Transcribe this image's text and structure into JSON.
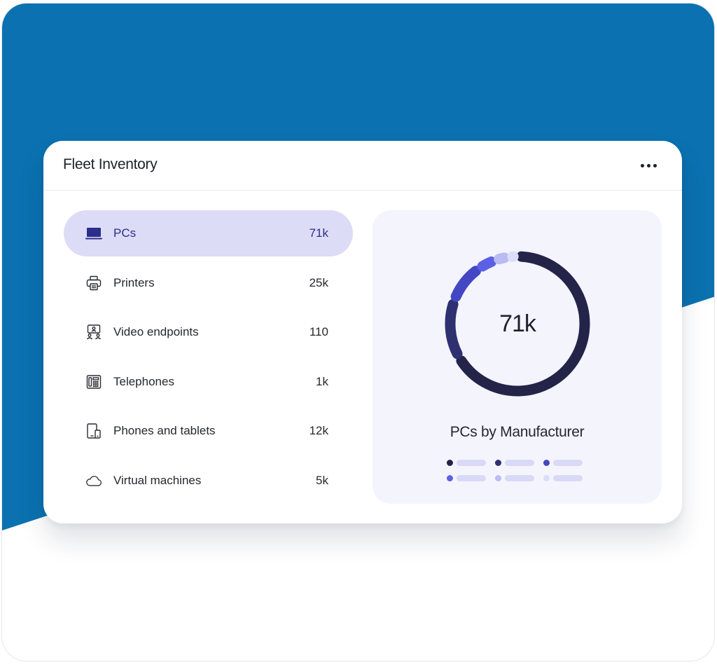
{
  "widget": {
    "title": "Fleet Inventory",
    "menu_icon": "more-horizontal-icon"
  },
  "inventory": {
    "items": [
      {
        "label": "PCs",
        "count": "71k",
        "icon": "laptop-icon",
        "selected": true
      },
      {
        "label": "Printers",
        "count": "25k",
        "icon": "printer-icon",
        "selected": false
      },
      {
        "label": "Video endpoints",
        "count": "110",
        "icon": "video-endpoint-icon",
        "selected": false
      },
      {
        "label": "Telephones",
        "count": "1k",
        "icon": "telephone-icon",
        "selected": false
      },
      {
        "label": "Phones and tablets",
        "count": "12k",
        "icon": "phone-tablet-icon",
        "selected": false
      },
      {
        "label": "Virtual machines",
        "count": "5k",
        "icon": "cloud-icon",
        "selected": false
      }
    ]
  },
  "chart": {
    "center_value": "71k",
    "title": "PCs by Manufacturer"
  },
  "colors": {
    "background_blue": "#0b71b0",
    "selected_row": "#dcdcf6",
    "panel": "#f4f4fd",
    "series": [
      "#232448",
      "#2e3070",
      "#4347c4",
      "#5c60e4",
      "#b9bbf2",
      "#dcddf8"
    ]
  },
  "chart_data": {
    "type": "pie",
    "values": [
      62,
      13,
      9,
      4,
      3,
      2
    ],
    "colors": [
      "#232448",
      "#2e3070",
      "#4347c4",
      "#5c60e4",
      "#b9bbf2",
      "#dcddf8"
    ]
  }
}
